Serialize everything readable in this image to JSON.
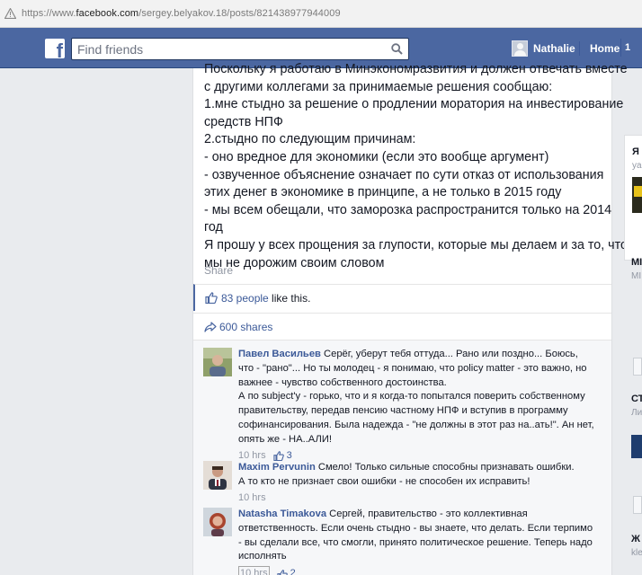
{
  "browser": {
    "url_prefix": "https://www.",
    "url_domain": "facebook.com",
    "url_path": "/sergey.belyakov.18/posts/821438977944009"
  },
  "topbar": {
    "search_placeholder": "Find friends",
    "user_name": "Nathalie",
    "home_label": "Home",
    "home_count": "1"
  },
  "post": {
    "lines": [
      "Поскольку я работаю в Минэкономразвития и должен отвечать вместе",
      "с другими коллегами за принимаемые решения сообщаю:",
      "1.мне стыдно за решение о продлении моратория на инвестирование",
      "средств НПФ",
      "2.стыдно по следующим причинам:",
      "- оно вредное для экономики (если это вообще аргумент)",
      "- озвученное объяснение означает по сути отказ от использования",
      "этих денег в экономике в принципе, а не только в 2015 году",
      "- мы всем обещали, что заморозка распространится только на 2014",
      "год",
      "Я прошу у всех прощения за глупости, которые мы делаем и за то, что",
      "мы не дорожим своим словом"
    ],
    "share_label": "Share",
    "likes_count": "83 people",
    "likes_suffix": " like this.",
    "shares_label": "600 shares"
  },
  "comments": [
    {
      "author": "Павел Васильев",
      "lines": [
        " Серёг, уберут тебя оттуда... Рано или поздно... Боюсь,",
        "что - \"рано\"... Но ты молодец - я понимаю, что policy matter - это важно, но",
        "важнее - чувство собственного достоинства.",
        "А по subject'у - горько, что и я когда-то попытался поверить собственному",
        "правительству, передав пенсию частному НПФ и вступив в программу",
        "софинансирования. Была надежда - \"не должны в этот раз на..ать!\". Ан нет,",
        "опять же - НА..АЛИ!"
      ],
      "time": "10 hrs",
      "likes": "3"
    },
    {
      "author": "Maxim Pervunin",
      "lines": [
        " Смело! Только сильные способны признавать ошибки.",
        "А то кто не признает свои ошибки - не способен их исправить!"
      ],
      "time": "10 hrs",
      "likes": ""
    },
    {
      "author": "Natasha Timakova",
      "lines": [
        " Сергей, правительство - это коллективная",
        "ответственность. Если очень стыдно - вы знаете, что делать. Если терпимо",
        "- вы сделали все, что смогли, принято политическое решение. Теперь надо",
        "исполнять"
      ],
      "time": "10 hrs",
      "likes": "2"
    }
  ],
  "sidebar": {
    "items": [
      "Я",
      "ya",
      "МІ",
      "МІ",
      "СТ",
      "Ли",
      "Ж",
      "kle"
    ]
  },
  "colors": {
    "brand": "#4b67a1",
    "link": "#3b5998",
    "meta": "#9197a3"
  }
}
